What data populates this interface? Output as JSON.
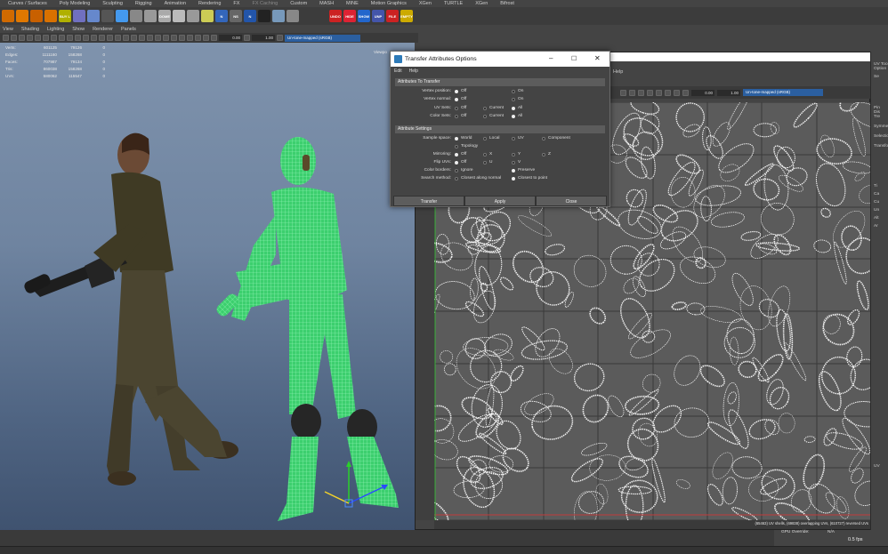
{
  "shelf_tabs": [
    "Curves / Surfaces",
    "Poly Modeling",
    "Sculpting",
    "Rigging",
    "Animation",
    "Rendering",
    "FX",
    "FX Caching",
    "Custom",
    "MASH",
    "MINE",
    "Motion Graphics",
    "XGen",
    "XGen",
    "TURTLE",
    "XGen",
    "Bifrost"
  ],
  "shelf_icons": [
    {
      "name": "orange-icon",
      "color": "#d06a00",
      "label": ""
    },
    {
      "name": "orange-icon",
      "color": "#e07800",
      "label": ""
    },
    {
      "name": "orange-icon",
      "color": "#c86000",
      "label": ""
    },
    {
      "name": "orange-icon",
      "color": "#d97100",
      "label": ""
    },
    {
      "name": "buy-live-icon",
      "color": "#b0b000",
      "label": "BUY LIVE"
    },
    {
      "name": "cube-icon",
      "color": "#7070c0",
      "label": ""
    },
    {
      "name": "sphere-icon",
      "color": "#6688cc",
      "label": ""
    },
    {
      "name": "sphere-icon",
      "color": "#555555",
      "label": ""
    },
    {
      "name": "torus-icon",
      "color": "#4499ee",
      "label": ""
    },
    {
      "name": "grid-icon",
      "color": "#888888",
      "label": ""
    },
    {
      "name": "pin-icon",
      "color": "#999999",
      "label": ""
    },
    {
      "name": "dome-icon",
      "color": "#aaaaaa",
      "label": "DOME"
    },
    {
      "name": "lamp-icon",
      "color": "#bbbbbb",
      "label": ""
    },
    {
      "name": "lamp-icon",
      "color": "#999999",
      "label": ""
    },
    {
      "name": "sun-icon",
      "color": "#cccc55",
      "label": ""
    },
    {
      "name": "n-icon",
      "color": "#3366bb",
      "label": "N"
    },
    {
      "name": "ns-icon",
      "color": "#666666",
      "label": "NS"
    },
    {
      "name": "n-icon",
      "color": "#2255aa",
      "label": "N"
    },
    {
      "name": "black-icon",
      "color": "#222222",
      "label": ""
    },
    {
      "name": "mesh-icon",
      "color": "#7799bb",
      "label": ""
    },
    {
      "name": "plane-icon",
      "color": "#888888",
      "label": ""
    },
    {
      "name": "undo-icon",
      "color": "#cc2222",
      "label": "UNDO"
    },
    {
      "name": "hide-icon",
      "color": "#dd2233",
      "label": "HIDE"
    },
    {
      "name": "show-icon",
      "color": "#2266cc",
      "label": "SHOW"
    },
    {
      "name": "unp-icon",
      "color": "#4455aa",
      "label": "UNP"
    },
    {
      "name": "file-icon",
      "color": "#cc2222",
      "label": "FILE"
    },
    {
      "name": "empty-group-icon",
      "color": "#ccaa00",
      "label": "EMPTY GROUP"
    }
  ],
  "panel_menu": [
    "View",
    "Shading",
    "Lighting",
    "Show",
    "Renderer",
    "Panels"
  ],
  "viewport_toolbar": {
    "field1": "0.00",
    "field2": "1.00",
    "colorspace": "Un-tone-mapped (sRGB)"
  },
  "hud": {
    "rows": [
      {
        "label": "Verts:",
        "c1": "601125",
        "c2": "79126",
        "c3": "0"
      },
      {
        "label": "Edges:",
        "c1": "1111160",
        "c2": "158268",
        "c3": "0"
      },
      {
        "label": "Faces:",
        "c1": "707987",
        "c2": "79134",
        "c3": "0"
      },
      {
        "label": "Tris:",
        "c1": "860038",
        "c2": "158268",
        "c3": "0"
      },
      {
        "label": "UVs:",
        "c1": "580062",
        "c2": "115547",
        "c3": "0"
      }
    ],
    "viewport_name": "Viewpo"
  },
  "uv_editor": {
    "menu_help": "Help",
    "field1": "0.00",
    "field2": "1.00",
    "colorspace": "Un-tone-mapped (sRGB)",
    "status": "(65463) UV shells, (69838) overlapping UVs, (610727) reversed UVs"
  },
  "right_panel": [
    "UV Too",
    "Option",
    "Se",
    "Pin",
    "Dis",
    "Tre",
    "Symme",
    "Selectio",
    "Transfo",
    "Ti",
    "Ca",
    "Cu",
    "Un",
    "Alt",
    "Ar",
    "UV"
  ],
  "status": {
    "gpu_label": "GPU Override:",
    "gpu_value": "N/A",
    "fps": "0.5 fps"
  },
  "dialog": {
    "title": "Transfer Attributes Options",
    "menu": [
      "Edit",
      "Help"
    ],
    "section1": "Attributes To Transfer",
    "section2": "Attribute Settings",
    "rows": {
      "vertex_position": {
        "label": "Vertex position:",
        "opts": [
          "Off",
          "On"
        ]
      },
      "vertex_normal": {
        "label": "Vertex normal:",
        "opts": [
          "Off",
          "On"
        ]
      },
      "uv_sets": {
        "label": "UV Sets:",
        "opts": [
          "Off",
          "Current",
          "All"
        ]
      },
      "color_sets": {
        "label": "Color Sets:",
        "opts": [
          "Off",
          "Current",
          "All"
        ]
      },
      "sample_space": {
        "label": "Sample space:",
        "opts": [
          "World",
          "Local",
          "UV",
          "Component",
          "Topology"
        ]
      },
      "mirroring": {
        "label": "Mirroring:",
        "opts": [
          "Off",
          "X",
          "Y",
          "Z"
        ]
      },
      "flip_uvs": {
        "label": "Flip UVs:",
        "opts": [
          "Off",
          "U",
          "V"
        ]
      },
      "color_borders": {
        "label": "Color borders:",
        "opts": [
          "Ignore",
          "Preserve"
        ]
      },
      "search_method": {
        "label": "Search method:",
        "opts": [
          "Closest along normal",
          "Closest to point"
        ]
      }
    },
    "buttons": {
      "transfer": "Transfer",
      "apply": "Apply",
      "close": "Close"
    }
  }
}
